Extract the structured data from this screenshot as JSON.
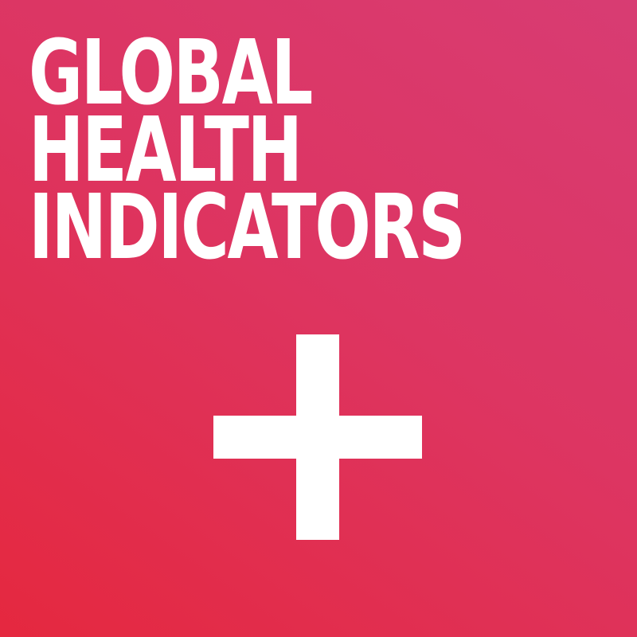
{
  "title": {
    "lines": [
      "GLOBAL",
      "HEALTH",
      "INDICATORS"
    ]
  },
  "icon": {
    "name": "plus-icon",
    "color": "#ffffff"
  },
  "colors": {
    "background_top_right": "#d83c73",
    "background_bottom_left": "#e5283f",
    "text": "#ffffff"
  }
}
